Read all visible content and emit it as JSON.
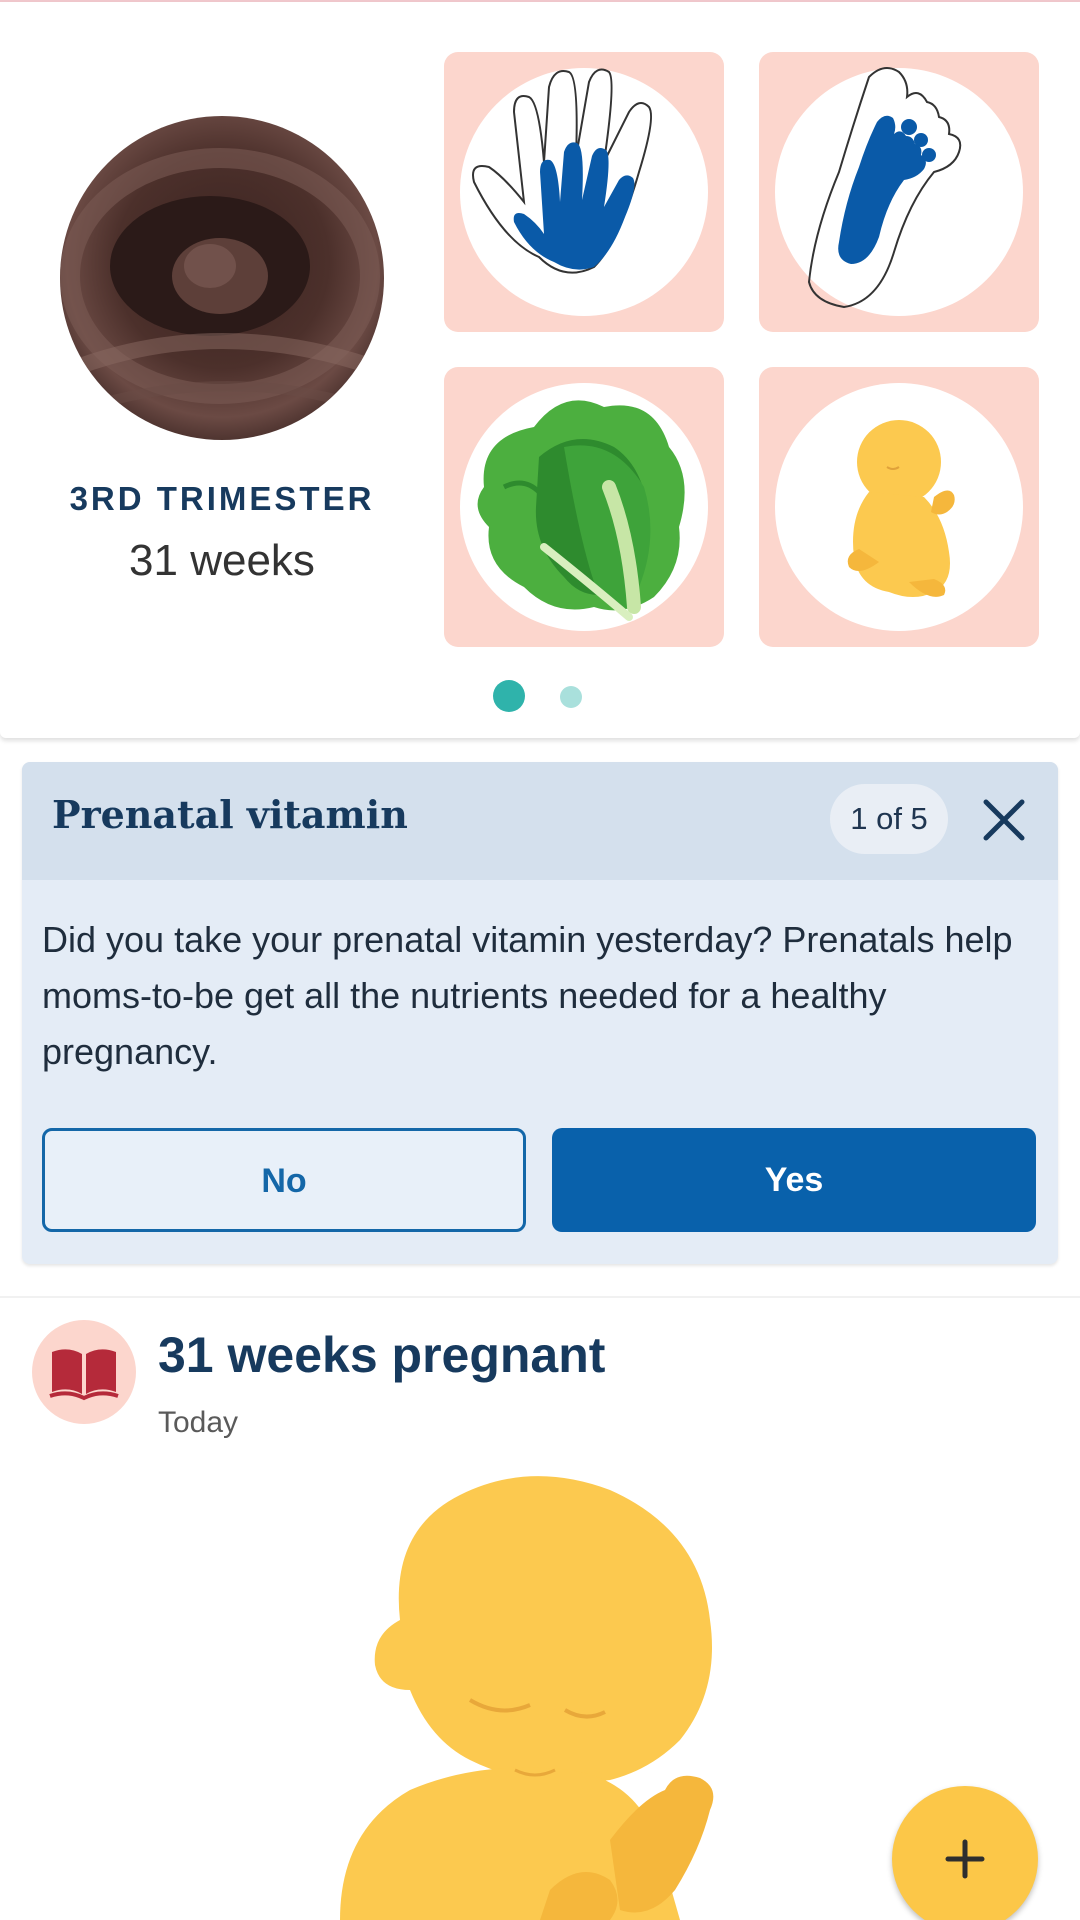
{
  "hero": {
    "trimester": "3RD TRIMESTER",
    "weeks": "31 weeks",
    "tiles": [
      {
        "name": "hand-size",
        "icon": "hand-icon"
      },
      {
        "name": "foot-size",
        "icon": "foot-icon"
      },
      {
        "name": "size-comparison",
        "icon": "romaine-lettuce-icon"
      },
      {
        "name": "baby-development",
        "icon": "fetus-icon"
      }
    ],
    "pager": {
      "count": 2,
      "active": 0
    }
  },
  "prompt": {
    "title": "Prenatal vitamin",
    "pager": "1 of 5",
    "body": "Did you take your prenatal vitamin yesterday? Prenatals help moms-to-be get all the nutrients needed for a healthy pregnancy.",
    "no_label": "No",
    "yes_label": "Yes"
  },
  "article": {
    "icon": "book-icon",
    "title": "31 weeks pregnant",
    "date": "Today"
  },
  "fab": {
    "label": "+",
    "icon": "plus-icon"
  },
  "colors": {
    "navy": "#173a5e",
    "tile_pink": "#fcd6cd",
    "primary_blue": "#0961ab",
    "dot_active": "#2fb3ab",
    "dot_inactive": "#a9e0dc",
    "baby_yellow": "#fcc94f",
    "fab_yellow": "#fcc748",
    "book_red": "#b52a3a"
  }
}
